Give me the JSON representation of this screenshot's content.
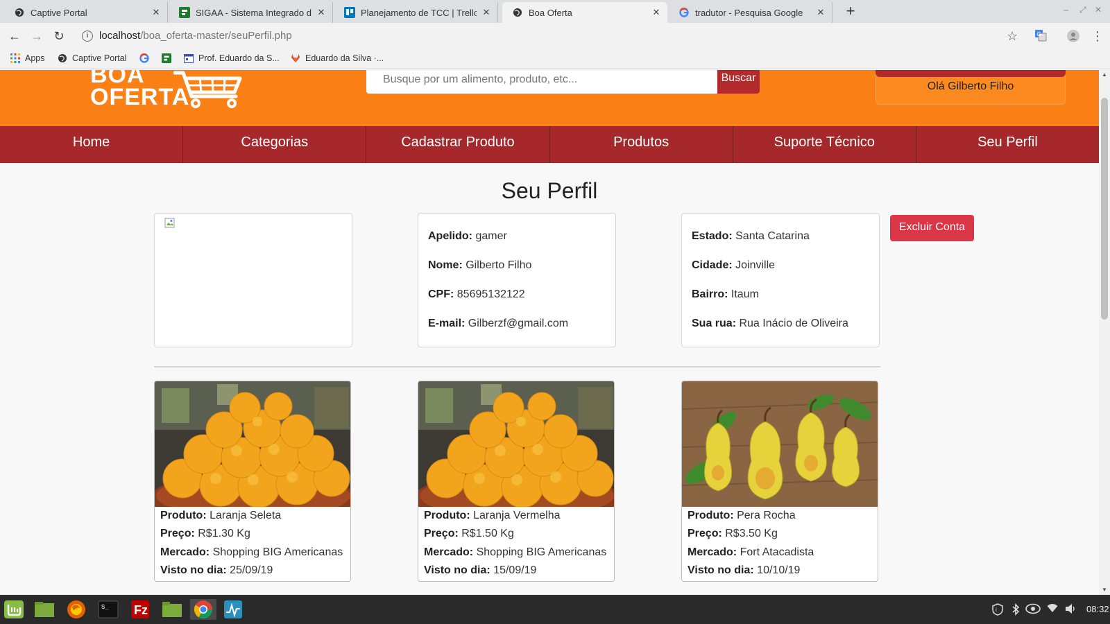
{
  "browser": {
    "tabs": [
      {
        "label": "Captive Portal",
        "active": false
      },
      {
        "label": "SIGAA - Sistema Integrado de G",
        "active": false
      },
      {
        "label": "Planejamento de TCC | Trello",
        "active": false
      },
      {
        "label": "Boa Oferta",
        "active": true
      },
      {
        "label": "tradutor - Pesquisa Google",
        "active": false
      }
    ],
    "url_host": "localhost",
    "url_path": "/boa_oferta-master/seuPerfil.php",
    "bookmarks": [
      {
        "label": "Apps"
      },
      {
        "label": "Captive Portal"
      },
      {
        "label": ""
      },
      {
        "label": ""
      },
      {
        "label": "Prof. Eduardo da S..."
      },
      {
        "label": "Eduardo da Silva ·..."
      }
    ]
  },
  "site": {
    "logo_line1": "BOA",
    "logo_line2": "OFERTA",
    "search_placeholder": "Busque por um alimento, produto, etc...",
    "search_button": "Buscar",
    "greeting": "Olá Gilberto Filho",
    "nav": [
      "Home",
      "Categorias",
      "Cadastrar Produto",
      "Produtos",
      "Suporte Técnico",
      "Seu Perfil"
    ]
  },
  "profile": {
    "title": "Seu Perfil",
    "personal": [
      {
        "label": "Apelido:",
        "value": "gamer"
      },
      {
        "label": "Nome:",
        "value": "Gilberto Filho"
      },
      {
        "label": "CPF:",
        "value": "85695132122"
      },
      {
        "label": "E-mail:",
        "value": "Gilberzf@gmail.com"
      }
    ],
    "address": [
      {
        "label": "Estado:",
        "value": "Santa Catarina"
      },
      {
        "label": "Cidade:",
        "value": "Joinville"
      },
      {
        "label": "Bairro:",
        "value": "Itaum"
      },
      {
        "label": "Sua rua:",
        "value": "Rua Inácio de Oliveira"
      }
    ],
    "delete_button": "Excluir Conta"
  },
  "products": [
    {
      "image": "oranges",
      "produto_label": "Produto:",
      "produto": "Laranja Seleta",
      "preco_label": "Preço:",
      "preco": "R$1.30 Kg",
      "mercado_label": "Mercado:",
      "mercado": "Shopping BIG Americanas",
      "visto_label": "Visto no dia:",
      "visto": "25/09/19"
    },
    {
      "image": "oranges",
      "produto_label": "Produto:",
      "produto": "Laranja Vermelha",
      "preco_label": "Preço:",
      "preco": "R$1.50 Kg",
      "mercado_label": "Mercado:",
      "mercado": "Shopping BIG Americanas",
      "visto_label": "Visto no dia:",
      "visto": "15/09/19"
    },
    {
      "image": "pears",
      "produto_label": "Produto:",
      "produto": "Pera Rocha",
      "preco_label": "Preço:",
      "preco": "R$3.50 Kg",
      "mercado_label": "Mercado:",
      "mercado": "Fort Atacadista",
      "visto_label": "Visto no dia:",
      "visto": "10/10/19"
    }
  ],
  "taskbar": {
    "clock": "08:32",
    "apps": [
      "mint-menu-icon",
      "show-desktop-icon",
      "firefox-icon",
      "terminal-icon",
      "filezilla-icon",
      "files-icon",
      "chrome-icon",
      "system-monitor-icon"
    ]
  },
  "colors": {
    "header": "#fb8117",
    "nav": "#a6282b",
    "delete": "#dc3545"
  }
}
